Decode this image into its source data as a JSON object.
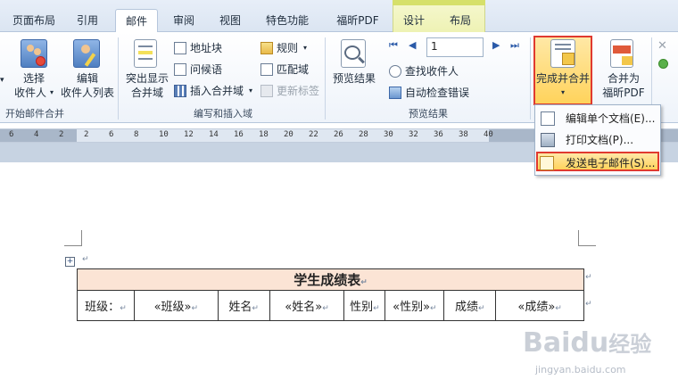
{
  "tabs": [
    "页面布局",
    "引用",
    "邮件",
    "审阅",
    "视图",
    "特色功能",
    "福昕PDF",
    "设计",
    "布局"
  ],
  "active_tab": "邮件",
  "ribbon": {
    "start_group": {
      "label": "开始邮件合并",
      "select_recipients": [
        "选择",
        "收件人"
      ],
      "edit_list": [
        "编辑",
        "收件人列表"
      ]
    },
    "write_group": {
      "label": "编写和插入域",
      "highlight_fields": [
        "突出显示",
        "合并域"
      ],
      "address_block": "地址块",
      "greeting_line": "问候语",
      "insert_merge_field": "插入合并域",
      "rules": "规则",
      "match_fields": "匹配域",
      "update_labels": "更新标签"
    },
    "preview_group": {
      "label": "预览结果",
      "preview_results": "预览结果",
      "record_number": "1",
      "find_recipient": "查找收件人",
      "auto_check": "自动检查错误"
    },
    "finish_group": {
      "finish_merge": "完成并合并",
      "merge_to_pdf": [
        "合并为",
        "福昕PDF"
      ]
    }
  },
  "menu": {
    "items": [
      "编辑单个文档(E)...",
      "打印文档(P)...",
      "发送电子邮件(S)..."
    ],
    "highlighted_index": 2
  },
  "ruler": {
    "numbers": [
      "6",
      "4",
      "2",
      "2",
      "6",
      "8",
      "10",
      "12",
      "14",
      "16",
      "18",
      "20",
      "22",
      "26",
      "28",
      "30",
      "32",
      "36",
      "38",
      "40"
    ]
  },
  "table": {
    "title": "学生成绩表",
    "row": [
      "班级：",
      "«班级»",
      "姓名",
      "«姓名»",
      "性别",
      "«性别»",
      "成绩",
      "«成绩»"
    ]
  },
  "watermark": {
    "brand": "Baidu",
    "suffix": "经验",
    "url": "jingyan.baidu.com"
  },
  "colors": {
    "accent_red": "#e03a2f",
    "highlight_yellow": "#ffd35c",
    "table_title_bg": "#fbe4d5"
  }
}
